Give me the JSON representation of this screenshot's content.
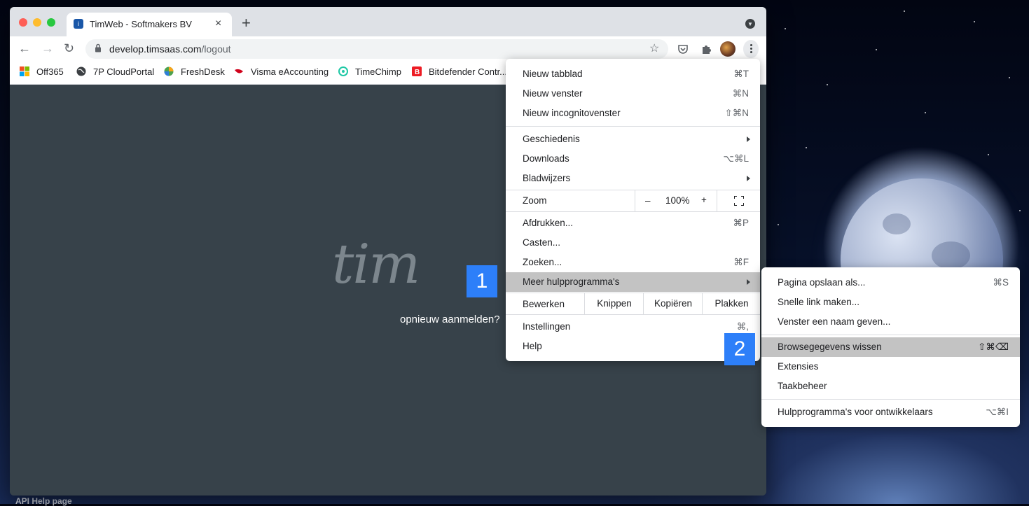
{
  "browser": {
    "tab_title": "TimWeb - Softmakers BV",
    "new_tab": "+",
    "url_domain": "develop.timsaas.com",
    "url_path": "/logout"
  },
  "bookmarks": [
    {
      "label": "Off365",
      "icon": "office-icon"
    },
    {
      "label": "7P CloudPortal",
      "icon": "globe-icon"
    },
    {
      "label": "FreshDesk",
      "icon": "freshdesk-icon"
    },
    {
      "label": "Visma eAccounting",
      "icon": "visma-icon"
    },
    {
      "label": "TimeChimp",
      "icon": "timechimp-icon"
    },
    {
      "label": "Bitdefender Contr...",
      "icon": "bitdefender-icon"
    }
  ],
  "page": {
    "logo_text": "tim",
    "relogin_link": "opnieuw aanmelden?"
  },
  "markers": {
    "one": "1",
    "two": "2"
  },
  "desktop": {
    "label": "API Help page"
  },
  "menu": {
    "new_tab": {
      "label": "Nieuw tabblad",
      "shortcut": "⌘T"
    },
    "new_window": {
      "label": "Nieuw venster",
      "shortcut": "⌘N"
    },
    "incognito": {
      "label": "Nieuw incognitovenster",
      "shortcut": "⇧⌘N"
    },
    "history": {
      "label": "Geschiedenis"
    },
    "downloads": {
      "label": "Downloads",
      "shortcut": "⌥⌘L"
    },
    "bookmarks": {
      "label": "Bladwijzers"
    },
    "zoom": {
      "label": "Zoom",
      "minus": "–",
      "value": "100%",
      "plus": "+"
    },
    "print": {
      "label": "Afdrukken...",
      "shortcut": "⌘P"
    },
    "cast": {
      "label": "Casten..."
    },
    "find": {
      "label": "Zoeken...",
      "shortcut": "⌘F"
    },
    "more_tools": {
      "label": "Meer hulpprogramma's"
    },
    "edit": {
      "label": "Bewerken",
      "cut": "Knippen",
      "copy": "Kopiëren",
      "paste": "Plakken"
    },
    "settings": {
      "label": "Instellingen",
      "shortcut": "⌘,"
    },
    "help": {
      "label": "Help"
    }
  },
  "submenu": {
    "save_page": {
      "label": "Pagina opslaan als...",
      "shortcut": "⌘S"
    },
    "quick_link": {
      "label": "Snelle link maken..."
    },
    "name_window": {
      "label": "Venster een naam geven..."
    },
    "clear_data": {
      "label": "Browsegegevens wissen",
      "shortcut": "⇧⌘⌫"
    },
    "extensions": {
      "label": "Extensies"
    },
    "task_manager": {
      "label": "Taakbeheer"
    },
    "dev_tools": {
      "label": "Hulpprogramma's voor ontwikkelaars",
      "shortcut": "⌥⌘I"
    }
  },
  "colors": {
    "accent_marker": "#2d7ff9",
    "page_bg": "#37424a",
    "highlight": "#c3c3c3"
  }
}
